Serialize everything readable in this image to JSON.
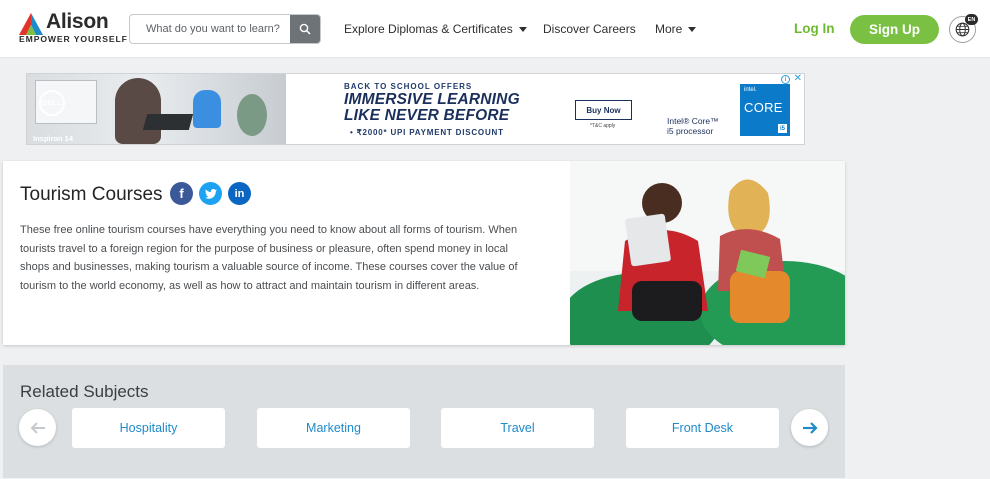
{
  "brand": {
    "name": "Alison",
    "tagline": "EMPOWER YOURSELF"
  },
  "search": {
    "placeholder": "What do you want to learn?"
  },
  "nav": {
    "explore": "Explore Diplomas & Certificates",
    "careers": "Discover Careers",
    "more": "More",
    "login": "Log In",
    "signup": "Sign Up",
    "language_badge": "EN"
  },
  "ad": {
    "kicker": "BACK TO SCHOOL OFFERS",
    "headline_line1": "IMMERSIVE LEARNING",
    "headline_line2": "LIKE NEVER BEFORE",
    "offer": "• ₹2000* UPI PAYMENT DISCOUNT",
    "buy_now": "Buy Now",
    "terms": "*T&C apply",
    "processor_line1": "Intel® Core™",
    "processor_line2": "i5 processor",
    "chip_brand": "intel.",
    "chip_core": "CORE",
    "chip_tier": "i5",
    "laptop_logo": "DELL",
    "laptop_model": "Inspiron 14",
    "choices_icon": "i",
    "close_icon": "✕"
  },
  "intro": {
    "title": "Tourism Courses",
    "description": "These free online tourism courses have everything you need to know about all forms of tourism. When tourists travel to a foreign region for the purpose of business or pleasure, often spend money in local shops and businesses, making tourism a valuable source of income. These courses cover the value of tourism to the world economy, as well as how to attract and maintain tourism in different areas.",
    "social": {
      "facebook": "f",
      "twitter": "t",
      "linkedin": "in"
    }
  },
  "related": {
    "title": "Related Subjects",
    "subjects": [
      "Hospitality",
      "Marketing",
      "Travel",
      "Front Desk"
    ]
  },
  "colors": {
    "brand_green": "#7ac143",
    "link_blue": "#1f8ac9",
    "facebook": "#3b5998",
    "twitter": "#1da1f2",
    "linkedin": "#0a66c2"
  }
}
